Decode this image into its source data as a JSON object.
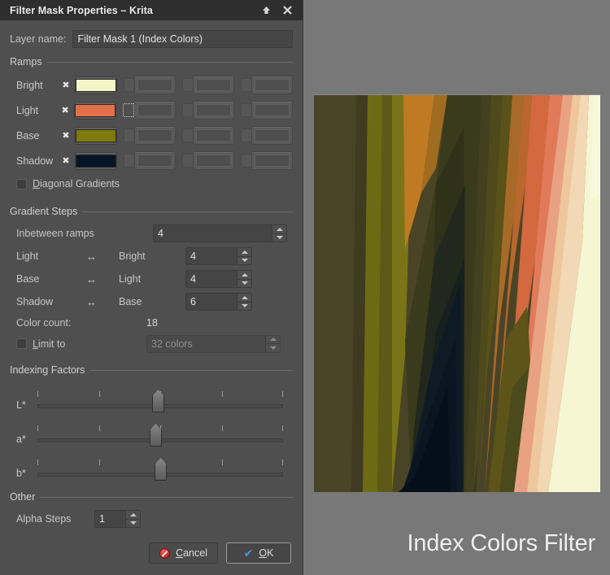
{
  "window": {
    "title": "Filter Mask Properties – Krita",
    "shade_icon": "up-arrow-icon",
    "close_icon": "close-icon"
  },
  "layer": {
    "label": "Layer name:",
    "value": "Filter Mask 1 (Index Colors)"
  },
  "ramps": {
    "group_title": "Ramps",
    "remove_glyph": "✖",
    "rows": [
      {
        "label": "Bright",
        "color": "#f4f5c8",
        "slots": 3
      },
      {
        "label": "Light",
        "color": "#e2704a",
        "slots": 3
      },
      {
        "label": "Base",
        "color": "#807a0c",
        "slots": 3
      },
      {
        "label": "Shadow",
        "color": "#061525",
        "slots": 3
      }
    ],
    "diagonal_gradients": {
      "label": "Diagonal Gradients",
      "underline_char": "D",
      "checked": false
    }
  },
  "gradient_steps": {
    "group_title": "Gradient Steps",
    "inbetween": {
      "label": "Inbetween ramps",
      "value": "4"
    },
    "pairs": [
      {
        "from": "Light",
        "arrow": "↔",
        "to": "Bright",
        "value": "4"
      },
      {
        "from": "Base",
        "arrow": "↔",
        "to": "Light",
        "value": "4"
      },
      {
        "from": "Shadow",
        "arrow": "↔",
        "to": "Base",
        "value": "6"
      }
    ],
    "color_count": {
      "label": "Color count:",
      "value": "18"
    },
    "limit_to": {
      "label": "Limit to",
      "underline_char": "L",
      "checked": false,
      "value": "32 colors",
      "enabled": false
    }
  },
  "indexing_factors": {
    "group_title": "Indexing Factors",
    "sliders": [
      {
        "label": "L*",
        "position_pct": 49,
        "ticks": 5
      },
      {
        "label": "a*",
        "position_pct": 48,
        "ticks": 5
      },
      {
        "label": "b*",
        "position_pct": 50,
        "ticks": 5
      }
    ]
  },
  "other": {
    "group_title": "Other",
    "alpha_steps": {
      "label": "Alpha Steps",
      "value": "1"
    }
  },
  "buttons": {
    "cancel": {
      "label": "Cancel",
      "underline_char": "C",
      "icon": "cancel-icon"
    },
    "ok": {
      "label": "OK",
      "underline_char": "O",
      "icon": "checkmark-icon",
      "is_default": true
    }
  },
  "preview": {
    "caption": "Index Colors Filter",
    "palette": {
      "cream": "#f6f7d2",
      "pale_peach": "#f2d8b4",
      "peach": "#eec79d",
      "salmon_light": "#e8a183",
      "salmon": "#e07a58",
      "orange": "#d4683f",
      "amber": "#c07a22",
      "olive": "#6d6a14",
      "olive_dark": "#4a4426",
      "green_dark": "#3a3a1c",
      "shadow_green": "#2a2e1e",
      "navy": "#0c1826",
      "navy_dark": "#06101c"
    }
  }
}
